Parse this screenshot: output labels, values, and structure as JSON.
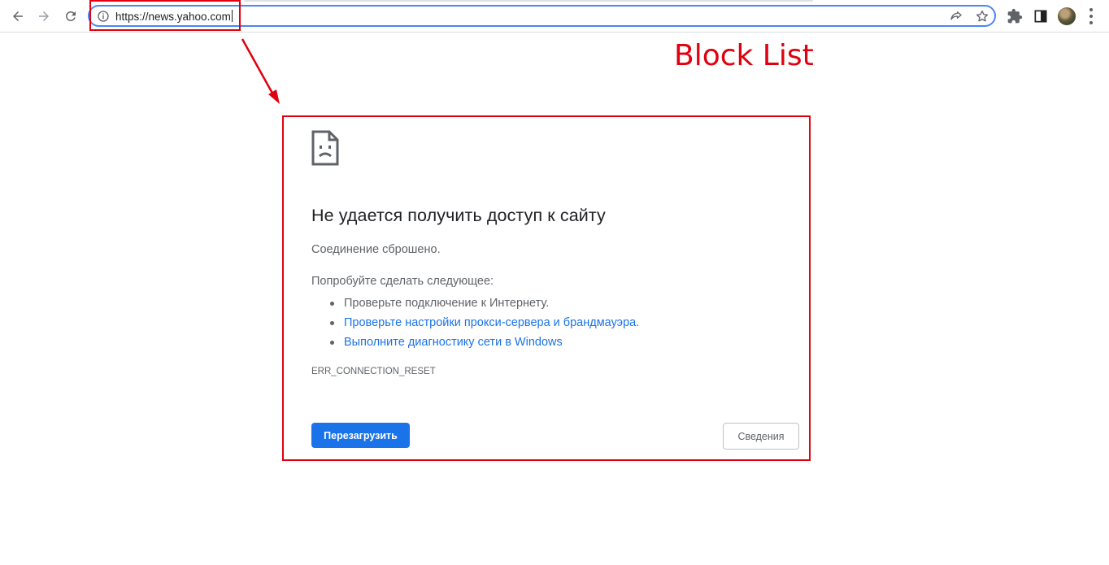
{
  "browser": {
    "url": "https://news.yahoo.com"
  },
  "annotation": {
    "label": "Block List",
    "color": "#e0000f"
  },
  "error_page": {
    "title": "Не удается получить доступ к сайту",
    "subtitle": "Соединение сброшено.",
    "try_heading": "Попробуйте сделать следующее:",
    "suggestions": [
      {
        "text": "Проверьте подключение к Интернету.",
        "is_link": false
      },
      {
        "text": "Проверьте настройки прокси-сервера и брандмауэра.",
        "is_link": true
      },
      {
        "text": "Выполните диагностику сети в Windows",
        "is_link": true
      }
    ],
    "error_code": "ERR_CONNECTION_RESET",
    "reload_label": "Перезагрузить",
    "details_label": "Сведения",
    "icon": "sad-page-icon"
  },
  "colors": {
    "accent": "#1a73e8",
    "omnibox_focus": "#4a85f5",
    "annotation": "#e0000f"
  }
}
